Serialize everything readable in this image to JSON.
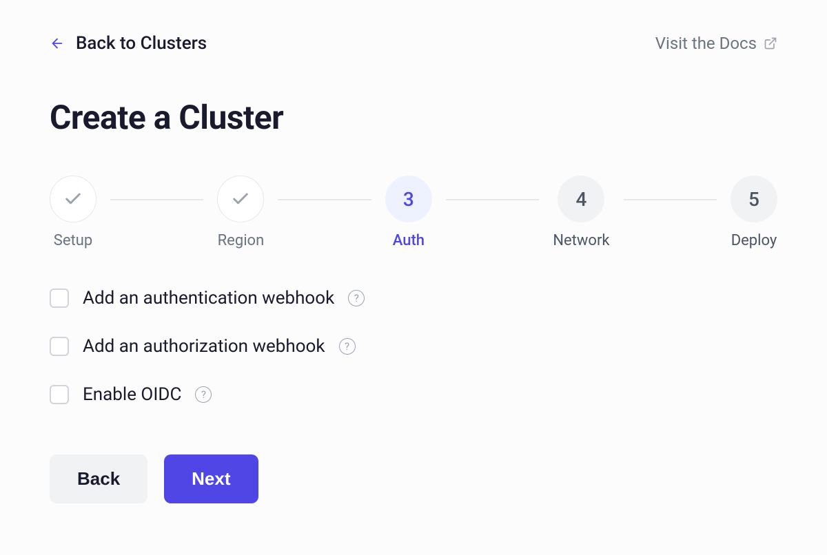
{
  "header": {
    "back_label": "Back to Clusters",
    "docs_label": "Visit the Docs"
  },
  "page_title": "Create a Cluster",
  "stepper": {
    "steps": [
      {
        "label": "Setup",
        "state": "completed"
      },
      {
        "label": "Region",
        "state": "completed"
      },
      {
        "label": "Auth",
        "state": "active",
        "number": "3"
      },
      {
        "label": "Network",
        "state": "upcoming",
        "number": "4"
      },
      {
        "label": "Deploy",
        "state": "upcoming",
        "number": "5"
      }
    ]
  },
  "options": [
    {
      "label": "Add an authentication webhook",
      "checked": false
    },
    {
      "label": "Add an authorization webhook",
      "checked": false
    },
    {
      "label": "Enable OIDC",
      "checked": false
    }
  ],
  "buttons": {
    "back": "Back",
    "next": "Next"
  }
}
